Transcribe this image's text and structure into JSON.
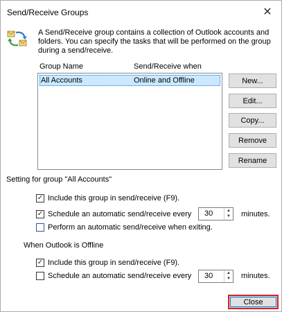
{
  "window": {
    "title": "Send/Receive Groups",
    "close_glyph": "✕"
  },
  "icons": {
    "dialog_icon": "send-receive-sync-icon"
  },
  "description": "A Send/Receive group contains a collection of Outlook accounts and folders. You can specify the tasks that will be performed on the group during a send/receive.",
  "groups_list": {
    "headers": [
      "Group Name",
      "Send/Receive when"
    ],
    "rows": [
      {
        "name": "All Accounts",
        "when": "Online and Offline",
        "selected": true
      }
    ]
  },
  "buttons": {
    "new": "New...",
    "edit": "Edit...",
    "copy": "Copy...",
    "remove": "Remove",
    "rename": "Rename",
    "close": "Close"
  },
  "online_section": {
    "label": "Setting for group \"All Accounts\"",
    "include": {
      "label": "Include this group in send/receive (F9).",
      "checked": true
    },
    "schedule": {
      "label": "Schedule an automatic send/receive every",
      "checked": true,
      "value": "30",
      "unit": "minutes."
    },
    "exit": {
      "label": "Perform an automatic send/receive when exiting.",
      "checked": false
    }
  },
  "offline_section": {
    "label": "When Outlook is Offline",
    "include": {
      "label": "Include this group in send/receive (F9).",
      "checked": true
    },
    "schedule": {
      "label": "Schedule an automatic send/receive every",
      "checked": false,
      "value": "30",
      "unit": "minutes."
    }
  },
  "colors": {
    "selection": "#cce8ff",
    "highlight_border": "#d42020",
    "button_face": "#e1e1e1"
  }
}
